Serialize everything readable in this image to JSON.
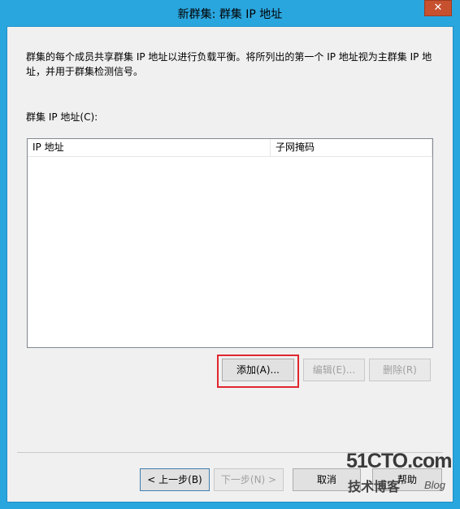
{
  "window": {
    "title": "新群集: 群集 IP 地址",
    "close_label": "✕"
  },
  "main": {
    "description": "群集的每个成员共享群集 IP 地址以进行负载平衡。将所列出的第一个 IP 地址视为主群集 IP 地址，并用于群集检测信号。",
    "list_label": "群集 IP 地址(C):",
    "columns": [
      "IP 地址",
      "子网掩码"
    ],
    "rows": []
  },
  "buttons": {
    "add": "添加(A)...",
    "edit": "编辑(E)...",
    "delete": "删除(R)"
  },
  "footer": {
    "back": "< 上一步(B)",
    "next": "下一步(N) >",
    "cancel": "取消",
    "help": "帮助"
  },
  "watermark": {
    "top": "51CTO.com",
    "bottom": "技术博客",
    "blog": "Blog"
  }
}
